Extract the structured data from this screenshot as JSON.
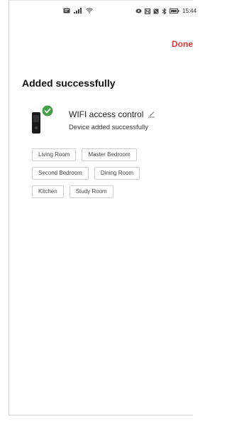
{
  "status_bar": {
    "time": "15:44"
  },
  "header": {
    "done_label": "Done"
  },
  "main": {
    "title": "Added successfully",
    "device": {
      "name": "WIFI access control",
      "status": "Device added successfully"
    },
    "rooms": [
      "Living Room",
      "Master Bedroom",
      "Second Bedroom",
      "Dining Room",
      "Kitchen",
      "Study Room"
    ]
  },
  "colors": {
    "accent": "#e53935",
    "success": "#43a047"
  }
}
